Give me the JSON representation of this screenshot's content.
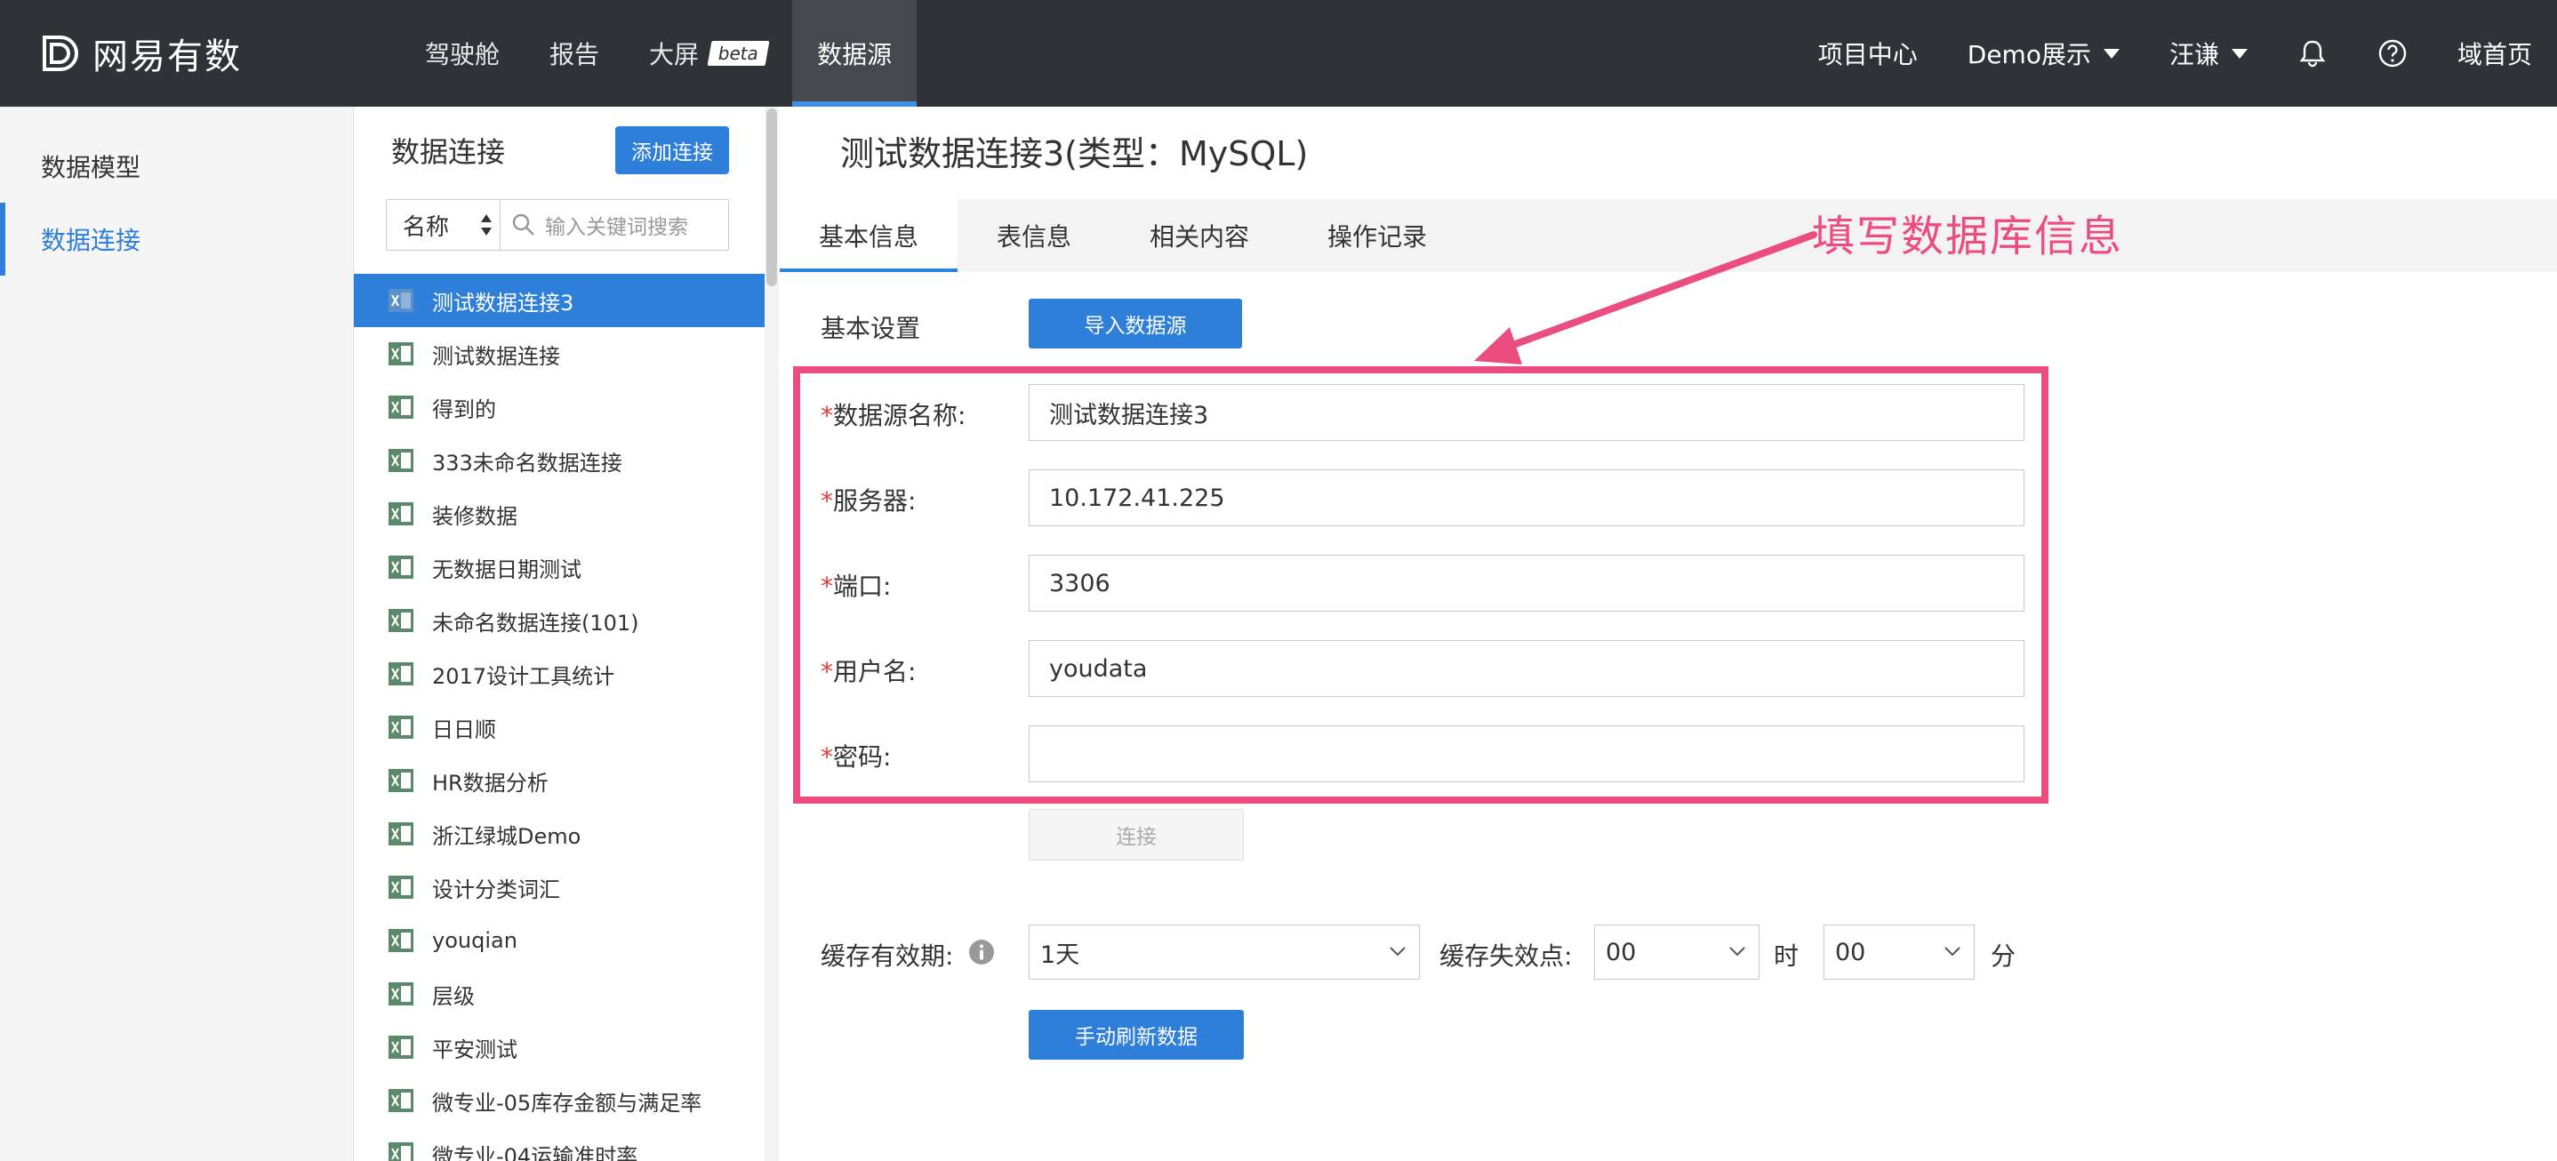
{
  "header": {
    "logo_text": "网易有数",
    "nav": [
      {
        "label": "驾驶舱"
      },
      {
        "label": "报告"
      },
      {
        "label": "大屏",
        "badge": "beta"
      },
      {
        "label": "数据源"
      }
    ],
    "right": {
      "project_center": "项目中心",
      "demo": "Demo展示",
      "user": "汪谦",
      "bell_icon": "bell-icon",
      "help_icon": "help-icon",
      "home": "域首页"
    }
  },
  "leftnav": {
    "items": [
      {
        "label": "数据模型"
      },
      {
        "label": "数据连接"
      }
    ]
  },
  "list_panel": {
    "title": "数据连接",
    "add_button": "添加连接",
    "filter_select": "名称",
    "search_placeholder": "输入关键词搜索",
    "items": [
      "测试数据连接3",
      "测试数据连接",
      "得到的",
      "333未命名数据连接",
      "装修数据",
      "无数据日期测试",
      "未命名数据连接(101)",
      "2017设计工具统计",
      "日日顺",
      "HR数据分析",
      "浙江绿城Demo",
      "设计分类词汇",
      "youqian",
      "层级",
      "平安测试",
      "微专业-05库存金额与满足率",
      "微专业-04运输准时率"
    ]
  },
  "main": {
    "title": "测试数据连接3(类型：MySQL)",
    "tabs": [
      "基本信息",
      "表信息",
      "相关内容",
      "操作记录"
    ],
    "basic_settings_label": "基本设置",
    "import_button": "导入数据源",
    "required_mark": "*",
    "fields": {
      "name_label": "数据源名称:",
      "name_value": "测试数据连接3",
      "server_label": "服务器:",
      "server_value": "10.172.41.225",
      "port_label": "端口:",
      "port_value": "3306",
      "user_label": "用户名:",
      "user_value": "youdata",
      "password_label": "密码:",
      "password_value": ""
    },
    "connect_button": "连接",
    "cache": {
      "label": "缓存有效期:",
      "value": "1天",
      "expire_label": "缓存失效点:",
      "hour_value": "00",
      "hour_unit": "时",
      "minute_value": "00",
      "minute_unit": "分"
    },
    "refresh_button": "手动刷新数据"
  },
  "annotation": {
    "text": "填写数据库信息",
    "color": "#eb4d7e"
  },
  "colors": {
    "topbar": "#2f3337",
    "accent": "#2e7fd9"
  }
}
